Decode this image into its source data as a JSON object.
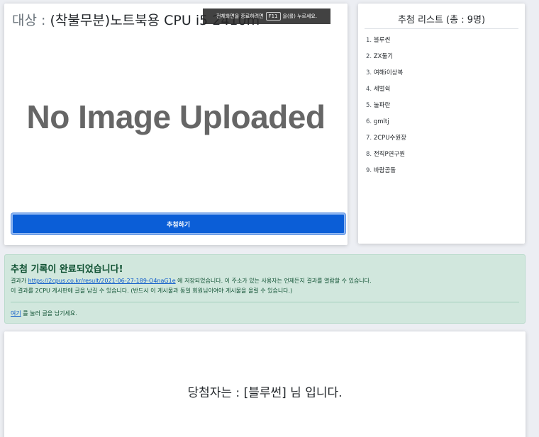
{
  "item": {
    "title_prefix": "대상 : ",
    "title_value": "(착불무분)노트북용 CPU i5 2410m",
    "image_placeholder": "No Image Uploaded",
    "draw_button_label": "추첨하기"
  },
  "fullscreen_notice": {
    "text_before": "전체화면을 종료하려면",
    "key": "F11",
    "text_after": "을(를) 누르세요."
  },
  "winner_list": {
    "title": "추첨 리스트 (총 : 9명)",
    "items": [
      {
        "num": "1.",
        "name": "블루썬"
      },
      {
        "num": "2.",
        "name": "ZX둘기"
      },
      {
        "num": "3.",
        "name": "여해i이상복"
      },
      {
        "num": "4.",
        "name": "세벌쉭"
      },
      {
        "num": "5.",
        "name": "눌파란"
      },
      {
        "num": "6.",
        "name": "gmltj"
      },
      {
        "num": "7.",
        "name": "2CPU수원장"
      },
      {
        "num": "8.",
        "name": "전직P연구원"
      },
      {
        "num": "9.",
        "name": "바람곰돌"
      }
    ]
  },
  "alert": {
    "heading": "추첨 기록이 완료되었습니다!",
    "line1_before": "결과가 ",
    "result_url": "https://2cpus.co.kr/result/2021-06-27-189-O4naG1e",
    "line1_after": " 에 저장되었습니다. 이 주소가 있는 사용자는 언제든지 결과를 열람할 수 있습니다.",
    "line2": "이 결과를 2CPU 게시판에 글을 남길 수 있습니다. (반드시 이 게시물과 동일 회원님이여야 게시물을 올릴 수 있습니다.)",
    "here_link": "여기",
    "line3_after": " 를 눌러 글을 남기세요."
  },
  "result": {
    "text": "당첨자는 : [블루썬] 님 입니다."
  },
  "colors": {
    "background": "#eceef3",
    "primary_button": "#0b5ed7",
    "alert_bg": "#d1e7dd",
    "alert_text": "#0f5132",
    "link": "#0a58ca"
  }
}
